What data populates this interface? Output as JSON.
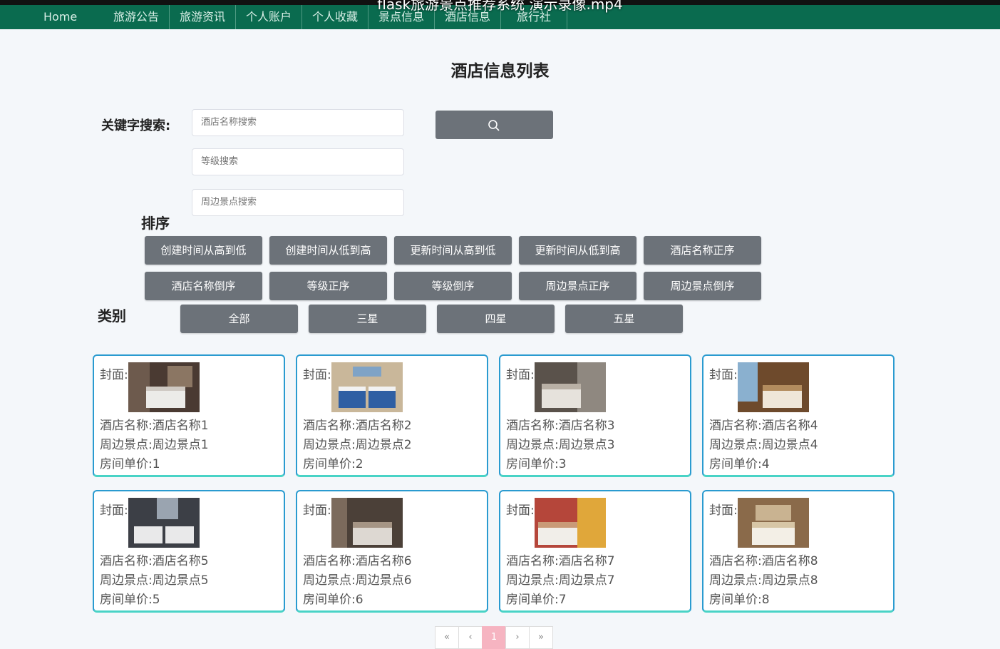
{
  "video_title": "flask旅游景点推荐系统 演示录像.mp4",
  "nav": [
    "Home",
    "旅游公告",
    "旅游资讯",
    "个人账户",
    "个人收藏",
    "景点信息",
    "酒店信息",
    "旅行社"
  ],
  "page_title": "酒店信息列表",
  "search": {
    "label": "关键字搜索:",
    "name_placeholder": "酒店名称搜索",
    "level_placeholder": "等级搜索",
    "scenic_placeholder": "周边景点搜索",
    "button_icon": "search-icon"
  },
  "sort": {
    "label": "排序",
    "buttons": [
      "创建时间从高到低",
      "创建时间从低到高",
      "更新时间从高到低",
      "更新时间从低到高",
      "酒店名称正序",
      "酒店名称倒序",
      "等级正序",
      "等级倒序",
      "周边景点正序",
      "周边景点倒序"
    ]
  },
  "category": {
    "label": "类别",
    "buttons": [
      "全部",
      "三星",
      "四星",
      "五星"
    ]
  },
  "cards": [
    {
      "cover": "封面:",
      "name": "酒店名称:酒店名称1",
      "scenic": "周边景点:周边景点1",
      "price": "房间单价:1"
    },
    {
      "cover": "封面:",
      "name": "酒店名称:酒店名称2",
      "scenic": "周边景点:周边景点2",
      "price": "房间单价:2"
    },
    {
      "cover": "封面:",
      "name": "酒店名称:酒店名称3",
      "scenic": "周边景点:周边景点3",
      "price": "房间单价:3"
    },
    {
      "cover": "封面:",
      "name": "酒店名称:酒店名称4",
      "scenic": "周边景点:周边景点4",
      "price": "房间单价:4"
    },
    {
      "cover": "封面:",
      "name": "酒店名称:酒店名称5",
      "scenic": "周边景点:周边景点5",
      "price": "房间单价:5"
    },
    {
      "cover": "封面:",
      "name": "酒店名称:酒店名称6",
      "scenic": "周边景点:周边景点6",
      "price": "房间单价:6"
    },
    {
      "cover": "封面:",
      "name": "酒店名称:酒店名称7",
      "scenic": "周边景点:周边景点7",
      "price": "房间单价:7"
    },
    {
      "cover": "封面:",
      "name": "酒店名称:酒店名称8",
      "scenic": "周边景点:周边景点8",
      "price": "房间单价:8"
    }
  ],
  "pagination": [
    "«",
    "‹",
    "1",
    "›",
    "»"
  ],
  "colors": {
    "nav_bg": "#0a6b4f",
    "button_bg": "#6c7279",
    "card_border": "#2a9bd0",
    "card_border_bottom": "#49d3c6",
    "active_page": "#f6b4c1"
  }
}
